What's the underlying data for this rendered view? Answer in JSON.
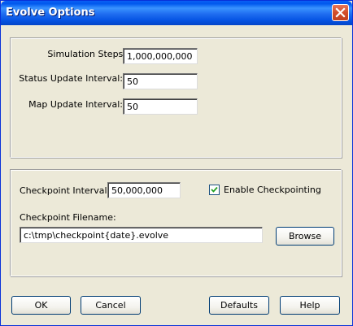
{
  "window": {
    "title": "Evolve Options"
  },
  "icons": {
    "close": "close-icon",
    "checkmark": "checkmark-icon"
  },
  "simulation_group": {
    "steps_label": "Simulation Steps:",
    "steps_value": "1,000,000,000",
    "status_label": "Status Update Interval:",
    "status_value": "50",
    "map_label": "Map Update Interval:",
    "map_value": "50"
  },
  "checkpoint_group": {
    "interval_label": "Checkpoint Interval:",
    "interval_value": "50,000,000",
    "enable_label": "Enable Checkpointing",
    "enable_checked": true,
    "filename_label": "Checkpoint Filename:",
    "filename_value": "c:\\tmp\\checkpoint{date}.evolve",
    "browse_label": "Browse"
  },
  "footer": {
    "ok_label": "OK",
    "cancel_label": "Cancel",
    "defaults_label": "Defaults",
    "help_label": "Help"
  },
  "colors": {
    "titlebar": "#0058ee",
    "dialog_background": "#ece9d8",
    "close_button": "#d34e2a",
    "button_border": "#003c74"
  }
}
